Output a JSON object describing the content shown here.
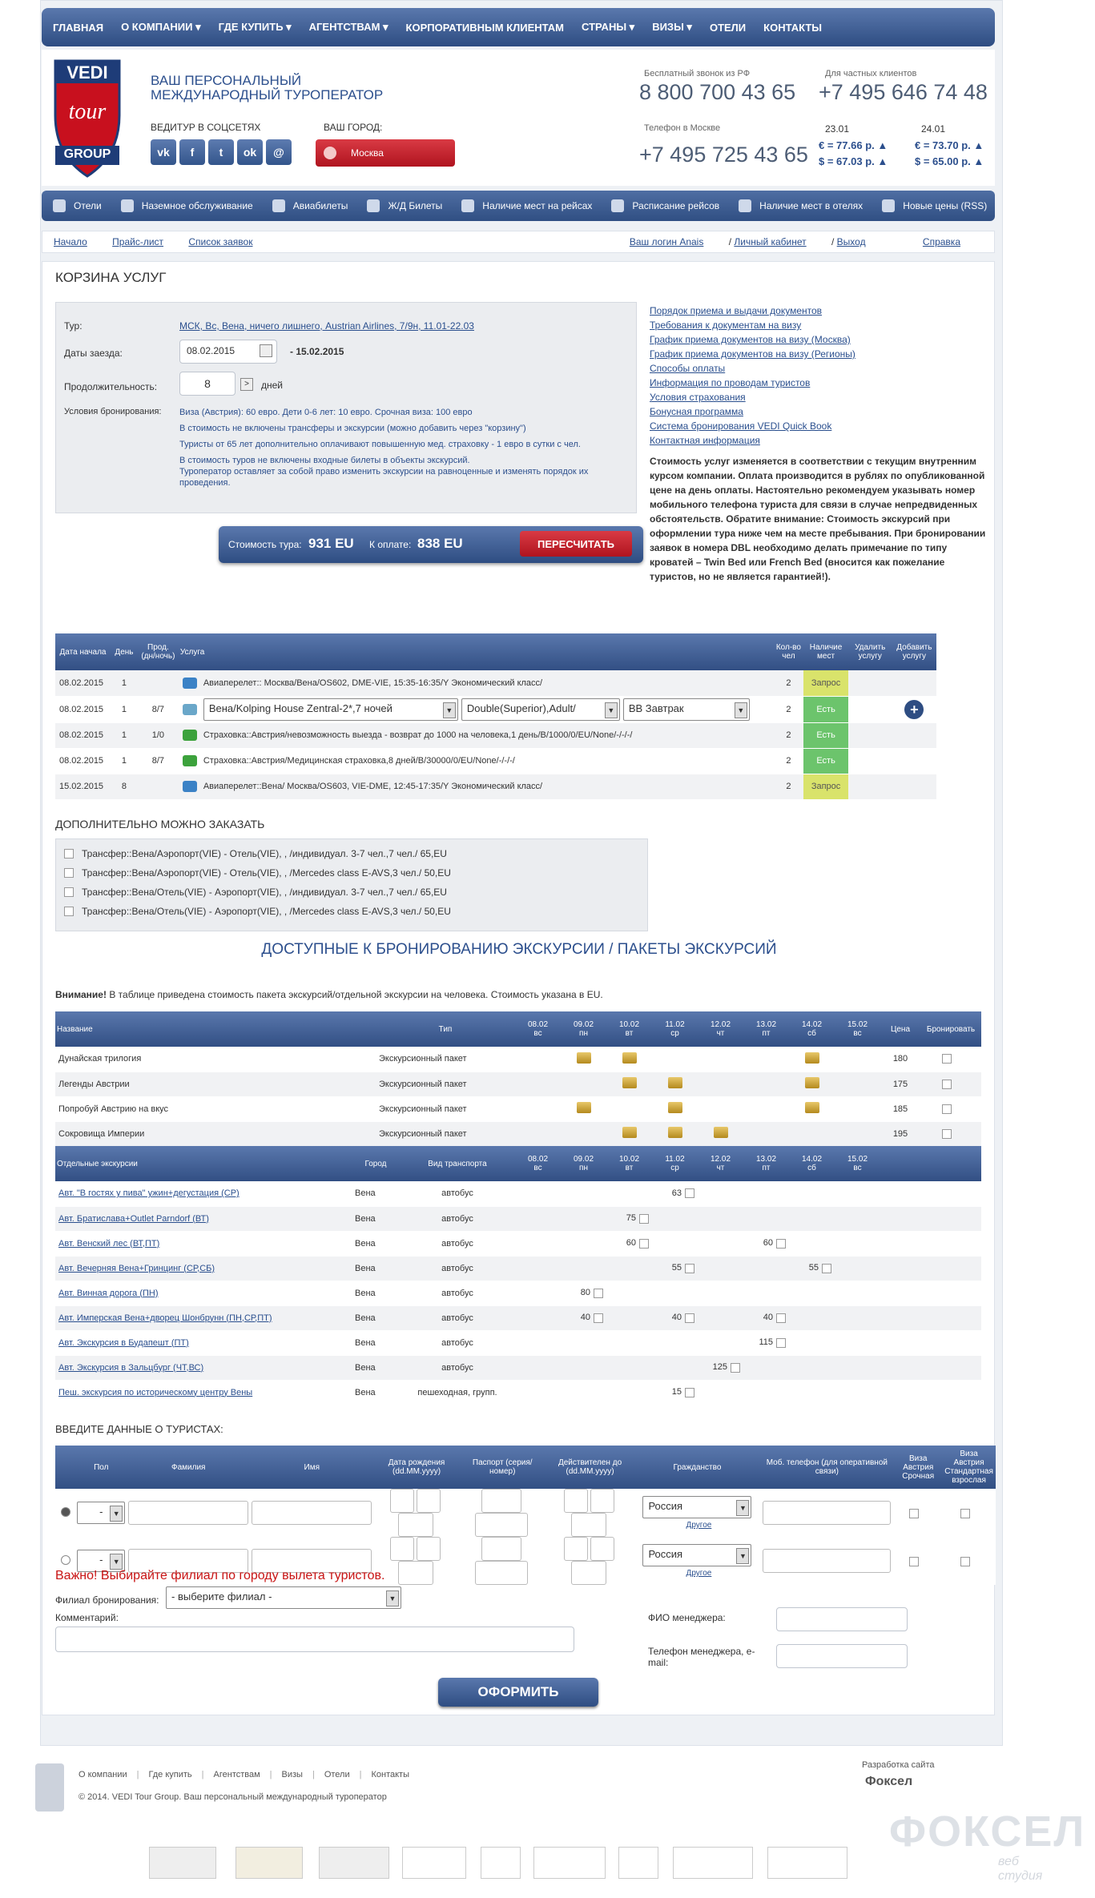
{
  "nav": {
    "items": [
      "ГЛАВНАЯ",
      "О КОМПАНИИ ▾",
      "ГДЕ КУПИТЬ ▾",
      "АГЕНТСТВАМ ▾",
      "КОРПОРАТИВНЫМ КЛИЕНТАМ",
      "СТРАНЫ ▾",
      "ВИЗЫ ▾",
      "ОТЕЛИ",
      "КОНТАКТЫ"
    ]
  },
  "header": {
    "logo_top": "VEDI",
    "logo_mid": "tour",
    "logo_bottom": "GROUP",
    "tagline": "ВАШ ПЕРСОНАЛЬНЫЙ МЕЖДУНАРОДНЫЙ ТУРОПЕРАТОР",
    "social_label": "ВЕДИТУР В СОЦСЕТЯХ",
    "social": [
      "vk",
      "f",
      "t",
      "ok",
      "@"
    ],
    "city_label": "ВАШ ГОРОД:",
    "city": "Москва",
    "free_call_label": "Бесплатный звонок из РФ",
    "free_call": "8 800 700 43 65",
    "private_label": "Для частных клиентов",
    "private_phone": "+7 495 646 74 48",
    "moscow_label": "Телефон в Москве",
    "moscow_phone": "+7 495 725 43 65",
    "date1": "23.01",
    "date2": "24.01",
    "eur1": "€ = 77.66 р. ▲",
    "usd1": "$ = 67.03 р. ▲",
    "eur2": "€ = 73.70 р. ▲",
    "usd2": "$ = 65.00 р. ▲"
  },
  "subnav": [
    "Отели",
    "Наземное обслуживание",
    "Авиабилеты",
    "Ж/Д Билеты",
    "Наличие мест на рейсах",
    "Расписание рейсов",
    "Наличие мест в отелях",
    "Новые цены (RSS)"
  ],
  "crumbs": {
    "left": [
      "Начало",
      "Прайс-лист",
      "Список заявок"
    ],
    "login": "Ваш логин Anais",
    "cabinet": "Личный кабинет",
    "logout": "Выход",
    "help": "Справка"
  },
  "cart": {
    "title": "КОРЗИНА УСЛУГ",
    "tour_label": "Тур:",
    "tour_value": "МСК, Вс, Вена, ничего лишнего, Austrian Airlines, 7/9н, 11.01-22.03",
    "dates_label": "Даты заезда:",
    "date_from": "08.02.2015",
    "date_to": "- 15.02.2015",
    "duration_label": "Продолжительность:",
    "duration": "8",
    "days": "дней",
    "conditions_label": "Условия бронирования:",
    "notes": [
      "Виза (Австрия): 60 евро. Дети 0-6 лет: 10 евро. Срочная виза: 100 евро",
      "В стоимость не включены трансферы и экскурсии (можно добавить через \"корзину\")",
      "Туристы от 65 лет дополнительно оплачивают повышенную мед. страховку - 1 евро в сутки с чел.",
      "В стоимость туров не включены входные билеты в объекты экскурсий.",
      "Туроператор оставляет за собой право изменить экскурсии на равноценные и изменять порядок их проведения."
    ],
    "links": [
      "Порядок приема и выдачи документов",
      "Требования к документам на визу",
      "График приема документов на визу (Москва)",
      "График приема документов на визу (Регионы)",
      "Способы оплаты",
      "Информация по проводам туристов",
      "Условия страхования",
      "Бонусная программа",
      "Система бронирования VEDI Quick Book",
      "Контактная информация"
    ],
    "right_note": "Стоимость услуг изменяется в соответствии с текущим внутренним курсом компании. Оплата производится в рублях по опубликованной цене на день оплаты. Настоятельно рекомендуем указывать номер мобильного телефона туриста для связи в случае непредвиденных обстоятельств. Обратите внимание: Стоимость экскурсий при оформлении тура ниже чем на месте пребывания. При бронировании заявок в номера DBL необходимо делать примечание по типу кроватей – Twin Bed или French Bed (вносится как пожелание туристов, но не является гарантией!).",
    "cost_label": "Стоимость тура:",
    "cost": "931 EU",
    "pay_label": "К оплате:",
    "pay": "838 EU",
    "recalc": "ПЕРЕСЧИТАТЬ"
  },
  "services": {
    "headers": [
      "Дата начала",
      "День",
      "Прод. (дн/ночь)",
      "Услуга",
      "Кол-во чел",
      "Наличие мест",
      "Удалить услугу",
      "Добавить услугу"
    ],
    "rows": [
      {
        "date": "08.02.2015",
        "day": "1",
        "dur": "",
        "text": "Авиаперелет:: Москва/Вена/OS602, DME-VIE, 15:35-16:35/Y Экономический класс/",
        "qty": "2",
        "status": "Запрос",
        "color": "#d9e36b"
      },
      {
        "date": "08.02.2015",
        "day": "1",
        "dur": "8/7",
        "hotel": "Вена/Kolping House Zentral-2*,7 ночей",
        "room": "Double(Superior),Adult/",
        "meal": "BB Завтрак",
        "qty": "2",
        "status": "Есть",
        "color": "#6cc46c"
      },
      {
        "date": "08.02.2015",
        "day": "1",
        "dur": "1/0",
        "text": "Страховка::Австрия/невозможность выезда - возврат до 1000 на человека,1 день/B/1000/0/EU/None/-/-/-/",
        "qty": "2",
        "status": "Есть",
        "color": "#6cc46c"
      },
      {
        "date": "08.02.2015",
        "day": "1",
        "dur": "8/7",
        "text": "Страховка::Австрия/Медицинская страховка,8 дней/B/30000/0/EU/None/-/-/-/",
        "qty": "2",
        "status": "Есть",
        "color": "#6cc46c"
      },
      {
        "date": "15.02.2015",
        "day": "8",
        "dur": "",
        "text": "Авиаперелет::Вена/ Москва/OS603, VIE-DME, 12:45-17:35/Y Экономический класс/",
        "qty": "2",
        "status": "Запрос",
        "color": "#d9e36b"
      }
    ]
  },
  "extra": {
    "title": "ДОПОЛНИТЕЛЬНО МОЖНО ЗАКАЗАТЬ",
    "items": [
      "Трансфер::Вена/Аэропорт(VIE) - Отель(VIE), , /индивидуал. 3-7 чел.,7 чел./ 65,EU",
      "Трансфер::Вена/Аэропорт(VIE) - Отель(VIE), , /Mercedes class E-AVS,3 чел./ 50,EU",
      "Трансфер::Вена/Отель(VIE) - Аэропорт(VIE), , /индивидуал. 3-7 чел.,7 чел./ 65,EU",
      "Трансфер::Вена/Отель(VIE) - Аэропорт(VIE), , /Mercedes class E-AVS,3 чел./ 50,EU"
    ]
  },
  "excursions": {
    "title": "ДОСТУПНЫЕ К БРОНИРОВАНИЮ ЭКСКУРСИИ / ПАКЕТЫ ЭКСКУРСИЙ",
    "warn_bold": "Внимание!",
    "warn": " В таблице приведена стоимость пакета экскурсий/отдельной экскурсии на человека. Стоимость указана в EU.",
    "days": [
      [
        "08.02",
        "вс"
      ],
      [
        "09.02",
        "пн"
      ],
      [
        "10.02",
        "вт"
      ],
      [
        "11.02",
        "ср"
      ],
      [
        "12.02",
        "чт"
      ],
      [
        "13.02",
        "пт"
      ],
      [
        "14.02",
        "сб"
      ],
      [
        "15.02",
        "вс"
      ]
    ],
    "pkg_headers": {
      "name": "Название",
      "type": "Тип",
      "price": "Цена",
      "book": "Бронировать"
    },
    "packages": [
      {
        "name": "Дунайская трилогия",
        "type": "Экскурсионный пакет",
        "marks": [
          0,
          1,
          1,
          0,
          0,
          0,
          1,
          0
        ],
        "price": "180"
      },
      {
        "name": "Легенды Австрии",
        "type": "Экскурсионный пакет",
        "marks": [
          0,
          0,
          1,
          1,
          0,
          0,
          1,
          0
        ],
        "price": "175"
      },
      {
        "name": "Попробуй Австрию на вкус",
        "type": "Экскурсионный пакет",
        "marks": [
          0,
          1,
          0,
          1,
          0,
          0,
          1,
          0
        ],
        "price": "185"
      },
      {
        "name": "Сокровища Империи",
        "type": "Экскурсионный пакет",
        "marks": [
          0,
          0,
          1,
          1,
          1,
          0,
          0,
          0
        ],
        "price": "195"
      }
    ],
    "sep_headers": {
      "name": "Отдельные экскурсии",
      "city": "Город",
      "transport": "Вид транспорта"
    },
    "singles": [
      {
        "name": "Авт. \"В гостях у пива\" ужин+дегустация (СР)",
        "city": "Вена",
        "tr": "автобус",
        "prices": [
          "",
          "",
          "",
          "63",
          "",
          "",
          "",
          ""
        ]
      },
      {
        "name": "Авт. Братислава+Outlet Parndorf (ВТ)",
        "city": "Вена",
        "tr": "автобус",
        "prices": [
          "",
          "",
          "75",
          "",
          "",
          "",
          "",
          ""
        ]
      },
      {
        "name": "Авт. Венский лес (ВТ,ПТ)",
        "city": "Вена",
        "tr": "автобус",
        "prices": [
          "",
          "",
          "60",
          "",
          "",
          "60",
          "",
          ""
        ]
      },
      {
        "name": "Авт. Вечерняя Вена+Гринцинг (СР,СБ)",
        "city": "Вена",
        "tr": "автобус",
        "prices": [
          "",
          "",
          "",
          "55",
          "",
          "",
          "55",
          ""
        ]
      },
      {
        "name": "Авт. Винная дорога (ПН)",
        "city": "Вена",
        "tr": "автобус",
        "prices": [
          "",
          "80",
          "",
          "",
          "",
          "",
          "",
          ""
        ]
      },
      {
        "name": "Авт. Имперская Вена+дворец Шонбрунн (ПН,СР,ПТ)",
        "city": "Вена",
        "tr": "автобус",
        "prices": [
          "",
          "40",
          "",
          "40",
          "",
          "40",
          "",
          ""
        ]
      },
      {
        "name": "Авт. Экскурсия в Будапешт (ПТ)",
        "city": "Вена",
        "tr": "автобус",
        "prices": [
          "",
          "",
          "",
          "",
          "",
          "115",
          "",
          ""
        ]
      },
      {
        "name": "Авт. Экскурсия в Зальцбург (ЧТ,ВС)",
        "city": "Вена",
        "tr": "автобус",
        "prices": [
          "",
          "",
          "",
          "",
          "125",
          "",
          "",
          ""
        ]
      },
      {
        "name": "Пеш. экскурсия по историческому центру Вены",
        "city": "Вена",
        "tr": "пешеходная, групп.",
        "prices": [
          "",
          "",
          "",
          "15",
          "",
          "",
          "",
          ""
        ]
      }
    ]
  },
  "tourists": {
    "title": "ВВЕДИТЕ ДАННЫЕ О ТУРИСТАХ:",
    "headers": [
      "Пол",
      "Фамилия",
      "Имя",
      "Дата рождения (dd.MM.yyyy)",
      "Паспорт (серия/номер)",
      "Действителен до (dd.MM.yyyy)",
      "Гражданство",
      "Моб. телефон (для оперативной связи)",
      "Виза Австрия Срочная",
      "Виза Австрия Стандартная взрослая"
    ],
    "gender": "-",
    "country": "Россия",
    "other": "Другое"
  },
  "booking": {
    "important": "Важно! Выбирайте филиал по городу вылета туристов.",
    "branch_label": "Филиал бронирования:",
    "branch_value": "- выберите филиал -",
    "comment_label": "Комментарий:",
    "manager_label": "ФИО менеджера:",
    "manager_phone_label": "Телефон менеджера, e-mail:",
    "submit": "ОФОРМИТЬ"
  },
  "footer": {
    "links": [
      "О компании",
      "Где купить",
      "Агентствам",
      "Визы",
      "Отели",
      "Контакты"
    ],
    "copyright": "© 2014. VEDI Tour Group. Ваш персональный международный туроператор",
    "dev_label": "Разработка сайта",
    "dev": "Фоксел",
    "watermark": "ФОКСЕЛ",
    "watermark_sub": "веб студия"
  },
  "colors": {
    "brand_blue": "#2e4d82",
    "accent_red": "#c81414",
    "status_yes": "#6cc46c",
    "status_req": "#d9e36b"
  }
}
